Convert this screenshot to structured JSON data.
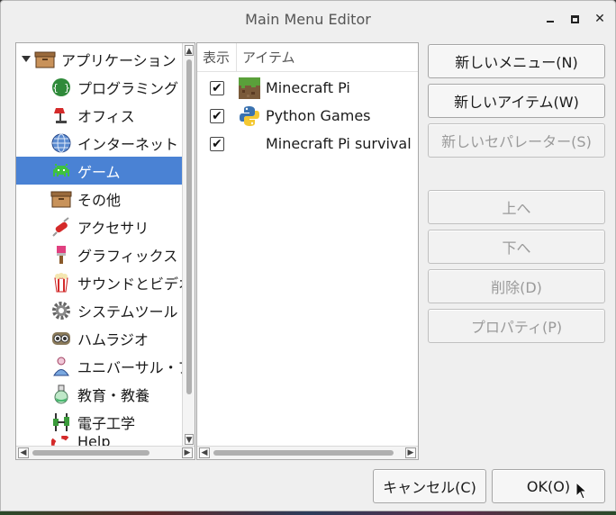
{
  "window": {
    "title": "Main Menu Editor"
  },
  "tree": {
    "root": {
      "label": "アプリケーション",
      "icon": "box-icon"
    },
    "items": [
      {
        "label": "プログラミング",
        "icon": "code-icon",
        "selected": false
      },
      {
        "label": "オフィス",
        "icon": "desk-lamp-icon",
        "selected": false
      },
      {
        "label": "インターネット",
        "icon": "globe-icon",
        "selected": false
      },
      {
        "label": "ゲーム",
        "icon": "space-invader-icon",
        "selected": true
      },
      {
        "label": "その他",
        "icon": "box-icon",
        "selected": false
      },
      {
        "label": "アクセサリ",
        "icon": "swiss-knife-icon",
        "selected": false
      },
      {
        "label": "グラフィックス",
        "icon": "paintbrush-icon",
        "selected": false
      },
      {
        "label": "サウンドとビデオ",
        "icon": "popcorn-icon",
        "selected": false
      },
      {
        "label": "システムツール",
        "icon": "gear-icon",
        "selected": false
      },
      {
        "label": "ハムラジオ",
        "icon": "headset-icon",
        "selected": false
      },
      {
        "label": "ユニバーサル・アクセス",
        "icon": "person-icon",
        "selected": false
      },
      {
        "label": "教育・教養",
        "icon": "flask-icon",
        "selected": false
      },
      {
        "label": "電子工学",
        "icon": "electronics-icon",
        "selected": false
      },
      {
        "label": "Help",
        "icon": "lifebuoy-icon",
        "selected": false
      }
    ]
  },
  "items_panel": {
    "columns": [
      "表示",
      "アイテム"
    ],
    "rows": [
      {
        "checked": true,
        "label": "Minecraft Pi",
        "icon": "minecraft-icon"
      },
      {
        "checked": true,
        "label": "Python Games",
        "icon": "python-icon"
      },
      {
        "checked": true,
        "label": "Minecraft Pi survival",
        "icon": "none"
      }
    ]
  },
  "buttons": {
    "new_menu": "新しいメニュー(N)",
    "new_item": "新しいアイテム(W)",
    "new_separator": "新しいセパレーター(S)",
    "move_up": "上へ",
    "move_down": "下へ",
    "delete": "削除(D)",
    "properties": "プロパティ(P)",
    "cancel": "キャンセル(C)",
    "ok": "OK(O)"
  },
  "colors": {
    "selection": "#4a82d4",
    "window_bg": "#efefef"
  }
}
